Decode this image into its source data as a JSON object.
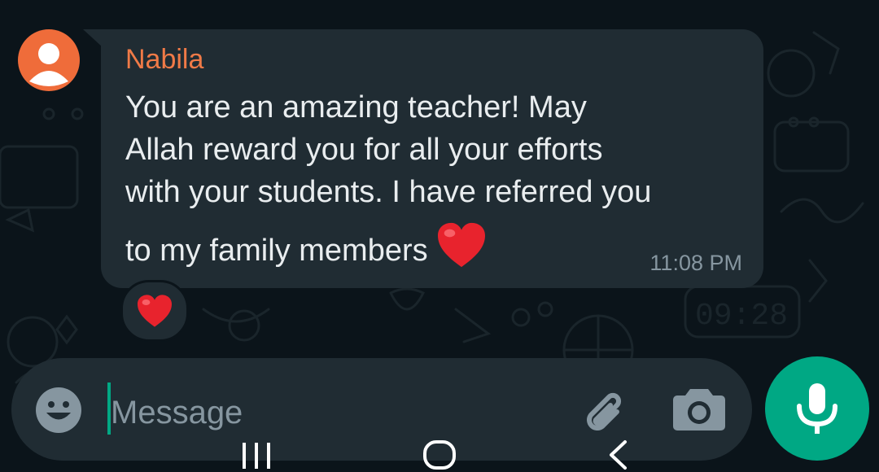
{
  "message": {
    "sender": "Nabila",
    "lines": [
      "You are an amazing teacher! May",
      "Allah reward you for all your efforts",
      "with your students. I have referred you",
      "to my family members"
    ],
    "timestamp": "11:08 PM",
    "inline_emoji": "heart-emoji",
    "reaction": "heart-emoji"
  },
  "composer": {
    "placeholder": "Message",
    "emoji_icon": "emoji-icon",
    "attach_icon": "paperclip-icon",
    "camera_icon": "camera-icon",
    "mic_icon": "microphone-icon"
  },
  "navbar": {
    "recent_icon": "recent-apps-icon",
    "home_icon": "home-icon",
    "back_icon": "back-icon"
  },
  "colors": {
    "background": "#0b141a",
    "bubble": "#202c33",
    "sender_name": "#f07a47",
    "avatar": "#ef6c3a",
    "text": "#e9edef",
    "meta": "#8696a0",
    "accent": "#00a884",
    "heart": "#e8232d"
  }
}
